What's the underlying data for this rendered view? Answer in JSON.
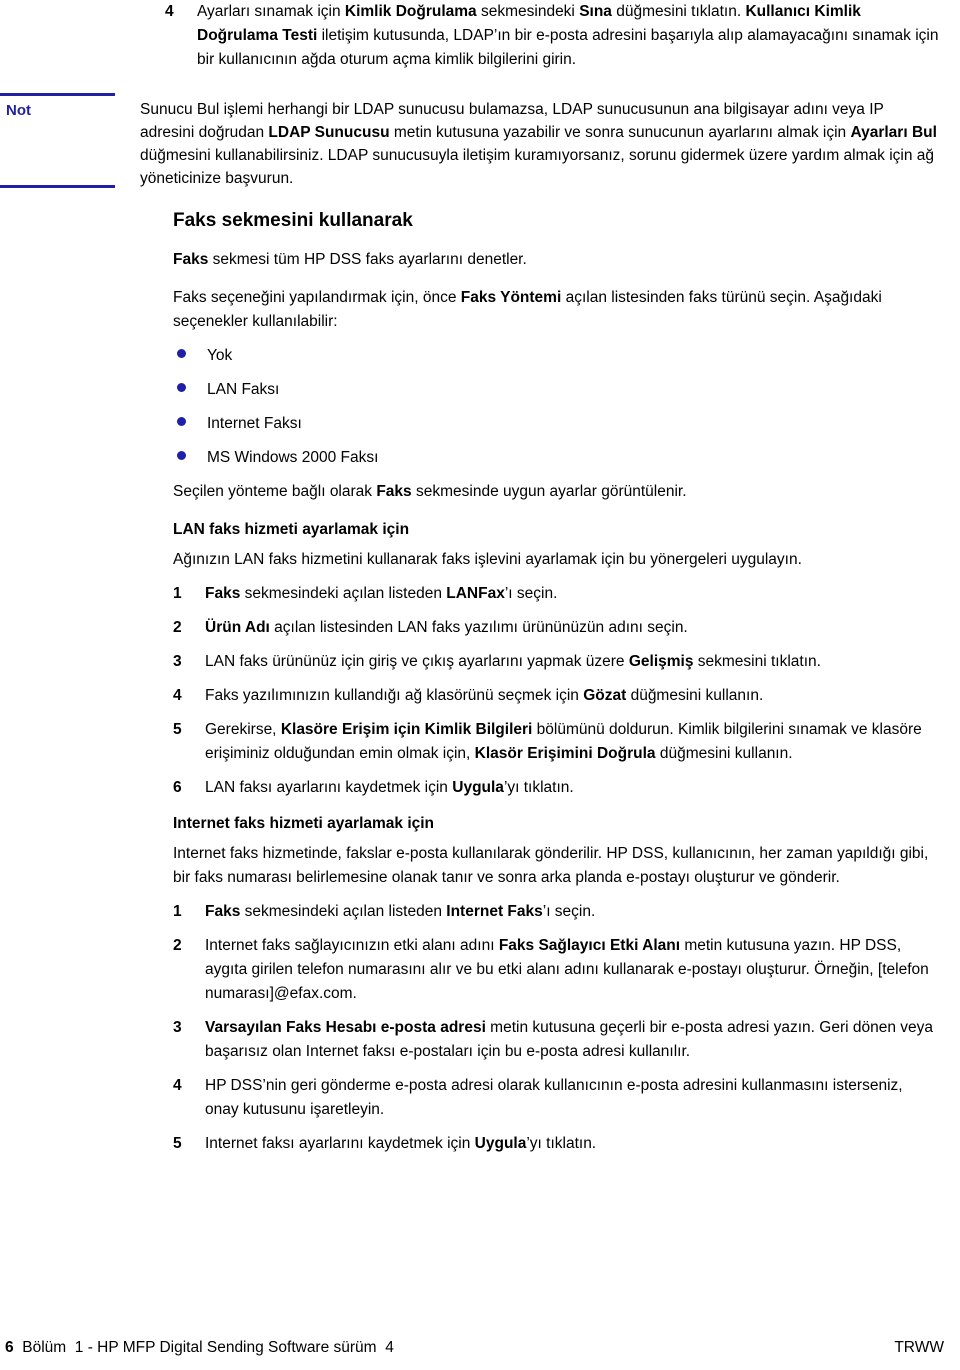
{
  "document": {
    "language": "tr",
    "accent_color": "#1f1fa8",
    "text_color": "#000000",
    "background_color": "#ffffff"
  },
  "top_step": {
    "number": "4",
    "line1_a": "Ayarları sınamak için ",
    "line1_b": "Kimlik Doğrulama",
    "line1_c": " sekmesindeki ",
    "line1_d": "Sına",
    "line1_e": " düğmesini tıklatın. ",
    "line1_f": "Kullanıcı Kimlik Doğrulama Testi",
    "line1_g": " iletişim kutusunda, LDAP’ın bir e-posta adresini başarıyla alıp alamayacağını sınamak için bir kullanıcının ağda oturum açma kimlik bilgilerini girin."
  },
  "note": {
    "label": "Not",
    "text_a": "Sunucu Bul işlemi herhangi bir LDAP sunucusu bulamazsa, LDAP sunucusunun ana bilgisayar adını veya IP adresini doğrudan ",
    "text_b": "LDAP Sunucusu",
    "text_c": " metin kutusuna yazabilir ve sonra sunucunun ayarlarını almak için ",
    "text_d": "Ayarları Bul",
    "text_e": " düğmesini kullanabilirsiniz. LDAP sunucusuyla iletişim kuramıyorsanız, sorunu gidermek üzere yardım almak için ağ yöneticinize başvurun."
  },
  "fax_section": {
    "heading": "Faks sekmesini kullanarak",
    "intro1_a": "Faks",
    "intro1_b": " sekmesi tüm HP DSS faks ayarlarını denetler.",
    "intro2_a": "Faks seçeneğini yapılandırmak için, önce ",
    "intro2_b": "Faks Yöntemi",
    "intro2_c": " açılan listesinden faks türünü seçin. Aşağıdaki seçenekler kullanılabilir:",
    "options": [
      "Yok",
      "LAN Faksı",
      "Internet Faksı",
      "MS Windows 2000 Faksı"
    ],
    "after_options_a": "Seçilen yönteme bağlı olarak ",
    "after_options_b": "Faks",
    "after_options_c": " sekmesinde uygun ayarlar görüntülenir."
  },
  "lan_fax": {
    "heading": "LAN faks hizmeti ayarlamak için",
    "intro": "Ağınızın LAN faks hizmetini kullanarak faks işlevini ayarlamak için bu yönergeleri uygulayın.",
    "steps": [
      {
        "number": "1",
        "a": "Faks",
        "b": " sekmesindeki açılan listeden ",
        "c": "LANFax",
        "d": "’ı seçin."
      },
      {
        "number": "2",
        "a": "Ürün Adı",
        "b": " açılan listesinden LAN faks yazılımı ürününüzün adını seçin.",
        "c": "",
        "d": ""
      },
      {
        "number": "3",
        "a": "",
        "b": "LAN faks ürününüz için giriş ve çıkış ayarlarını yapmak üzere ",
        "c": "Gelişmiş",
        "d": " sekmesini tıklatın."
      },
      {
        "number": "4",
        "a": "",
        "b": "Faks yazılımınızın kullandığı ağ klasörünü seçmek için ",
        "c": "Gözat",
        "d": " düğmesini kullanın."
      },
      {
        "number": "5",
        "a": "",
        "b": "Gerekirse, ",
        "c": "Klasöre Erişim için Kimlik Bilgileri",
        "d": " bölümünü doldurun. Kimlik bilgilerini sınamak ve klasöre erişiminiz olduğundan emin olmak için, ",
        "e": "Klasör Erişimini Doğrula",
        "f": " düğmesini kullanın."
      },
      {
        "number": "6",
        "a": "",
        "b": "LAN faksı ayarlarını kaydetmek için ",
        "c": "Uygula",
        "d": "’yı tıklatın."
      }
    ]
  },
  "internet_fax": {
    "heading": "Internet faks hizmeti ayarlamak için",
    "intro": "Internet faks hizmetinde, fakslar e-posta kullanılarak gönderilir. HP DSS, kullanıcının, her zaman yapıldığı gibi, bir faks numarası belirlemesine olanak tanır ve sonra arka planda e-postayı oluşturur ve gönderir.",
    "steps": [
      {
        "number": "1",
        "a": "Faks",
        "b": " sekmesindeki açılan listeden ",
        "c": "Internet Faks",
        "d": "’ı seçin."
      },
      {
        "number": "2",
        "a": "",
        "b": "Internet faks sağlayıcınızın etki alanı adını ",
        "c": "Faks Sağlayıcı Etki Alanı",
        "d": " metin kutusuna yazın. HP DSS, aygıta girilen telefon numarasını alır ve bu etki alanı adını kullanarak e-postayı oluşturur. Örneğin, [telefon numarası]@efax.com."
      },
      {
        "number": "3",
        "a": "",
        "b": "",
        "c": "Varsayılan Faks Hesabı e-posta adresi",
        "d": " metin kutusuna geçerli bir e-posta adresi yazın. Geri dönen veya başarısız olan Internet faksı e-postaları için bu e-posta adresi kullanılır."
      },
      {
        "number": "4",
        "a": "",
        "b": "HP DSS’nin geri gönderme e-posta adresi olarak kullanıcının e-posta adresini kullanmasını isterseniz, onay kutusunu işaretleyin.",
        "c": "",
        "d": ""
      },
      {
        "number": "5",
        "a": "",
        "b": "Internet faksı ayarlarını kaydetmek için ",
        "c": "Uygula",
        "d": "’yı tıklatın."
      }
    ]
  },
  "footer": {
    "page_number": "6",
    "chapter_text": "  Bölüm  1 - HP MFP Digital Sending Software sürüm  4",
    "right_label": "TRWW"
  }
}
